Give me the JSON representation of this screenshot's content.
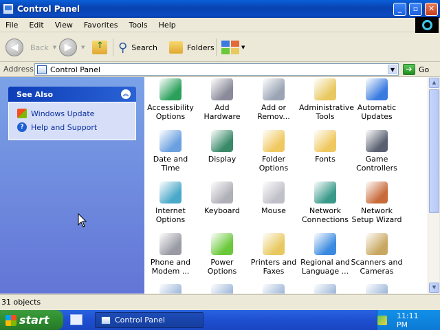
{
  "window": {
    "title": "Control Panel"
  },
  "menu": [
    "File",
    "Edit",
    "View",
    "Favorites",
    "Tools",
    "Help"
  ],
  "toolbar": {
    "back": "Back",
    "search": "Search",
    "folders": "Folders"
  },
  "address": {
    "label": "Address",
    "value": "Control Panel",
    "go": "Go"
  },
  "sidebar": {
    "see_also_title": "See Also",
    "links": [
      {
        "label": "Windows Update",
        "icon": "windows-update-icon"
      },
      {
        "label": "Help and Support",
        "icon": "help-icon"
      }
    ]
  },
  "items": [
    {
      "label": "Accessibility Options",
      "icon": "accessibility-icon",
      "color": "#2aa05a"
    },
    {
      "label": "Add Hardware",
      "icon": "add-hardware-icon",
      "color": "#8a8a9a"
    },
    {
      "label": "Add or Remov...",
      "icon": "add-remove-programs-icon",
      "color": "#9aa4b4"
    },
    {
      "label": "Administrative Tools",
      "icon": "administrative-tools-icon",
      "color": "#e8c860"
    },
    {
      "label": "Automatic Updates",
      "icon": "automatic-updates-icon",
      "color": "#3a7be0"
    },
    {
      "label": "Date and Time",
      "icon": "date-time-icon",
      "color": "#6aa0e0"
    },
    {
      "label": "Display",
      "icon": "display-icon",
      "color": "#3a8a6a"
    },
    {
      "label": "Folder Options",
      "icon": "folder-options-icon",
      "color": "#f0c860"
    },
    {
      "label": "Fonts",
      "icon": "fonts-icon",
      "color": "#f0c860"
    },
    {
      "label": "Game Controllers",
      "icon": "game-controllers-icon",
      "color": "#5a6070"
    },
    {
      "label": "Internet Options",
      "icon": "internet-options-icon",
      "color": "#4aa8c8"
    },
    {
      "label": "Keyboard",
      "icon": "keyboard-icon",
      "color": "#b0b0b8"
    },
    {
      "label": "Mouse",
      "icon": "mouse-icon",
      "color": "#c0c0c8"
    },
    {
      "label": "Network Connections",
      "icon": "network-connections-icon",
      "color": "#3a9a8a"
    },
    {
      "label": "Network Setup Wizard",
      "icon": "network-setup-wizard-icon",
      "color": "#c86a3a"
    },
    {
      "label": "Phone and Modem ...",
      "icon": "phone-modem-icon",
      "color": "#9a9aa4"
    },
    {
      "label": "Power Options",
      "icon": "power-options-icon",
      "color": "#6ac83a"
    },
    {
      "label": "Printers and Faxes",
      "icon": "printers-faxes-icon",
      "color": "#e8c860"
    },
    {
      "label": "Regional and Language ...",
      "icon": "regional-language-icon",
      "color": "#3a8ae0"
    },
    {
      "label": "Scanners and Cameras",
      "icon": "scanners-cameras-icon",
      "color": "#c8a860"
    }
  ],
  "status": {
    "objects": "31 objects"
  },
  "taskbar": {
    "start": "start",
    "task": "Control Panel",
    "clock": "11:11 PM"
  }
}
